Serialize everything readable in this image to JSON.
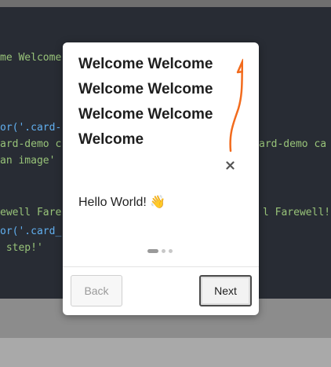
{
  "editor": {
    "lines": [
      "me Welcome",
      "or('.card-",
      "ard-demo c",
      "an image'",
      "ewell Fare",
      "or('.card_",
      " step!'"
    ],
    "right_lines": [
      "ard-demo ca",
      "l Farewell!"
    ]
  },
  "tour": {
    "title": "Welcome Welcome Welcome Welcome Welcome Welcome Welcome",
    "body": "Hello World! 👋",
    "back_label": "Back",
    "next_label": "Next",
    "steps_total": 3,
    "current_step": 1
  },
  "colors": {
    "annotation_arrow": "#f26b1d",
    "editor_bg": "#282c34"
  },
  "icons": {
    "close": "close-icon",
    "annotation": "arrow-annotation"
  }
}
